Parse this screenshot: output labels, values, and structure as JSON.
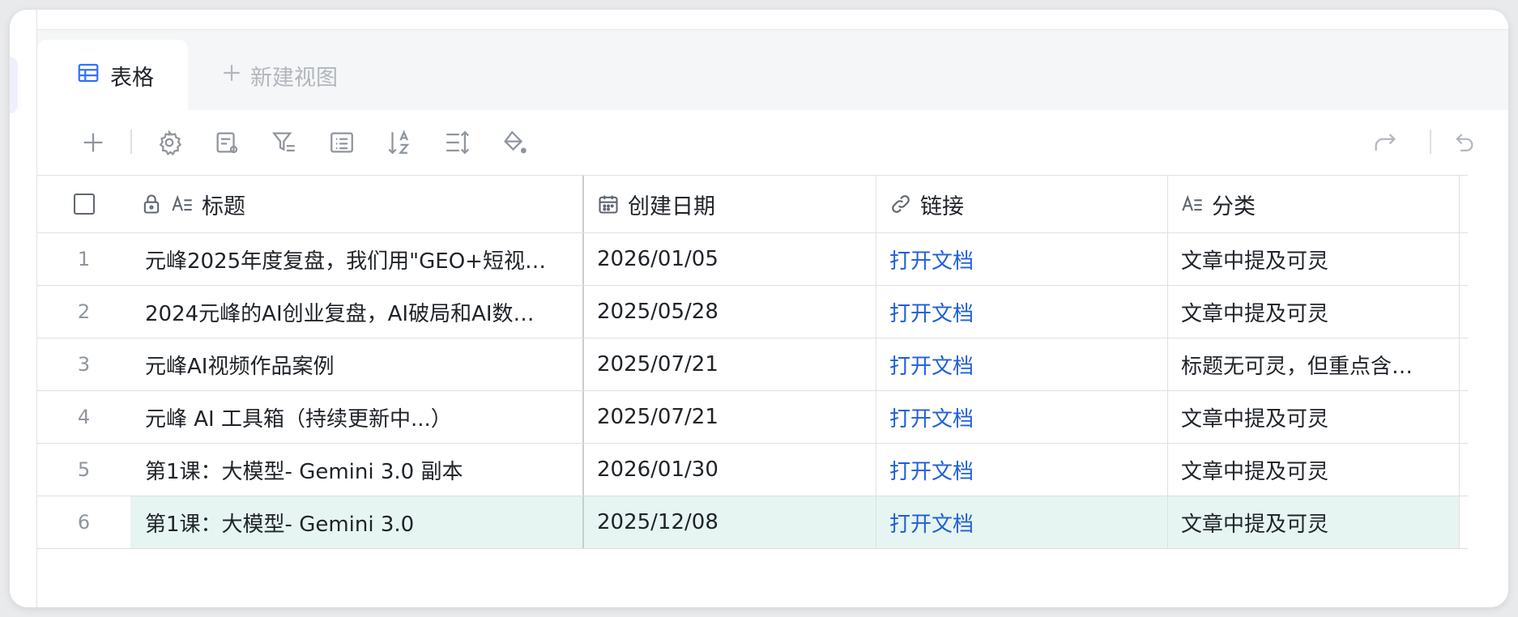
{
  "tabs": {
    "active_label": "表格",
    "new_view_label": "新建视图"
  },
  "toolbar": {
    "icons": [
      "plus-icon",
      "gear-icon",
      "field-settings-icon",
      "filter-icon",
      "group-icon",
      "sort-icon",
      "row-height-icon",
      "fill-color-icon",
      "redo-icon",
      "undo-icon"
    ]
  },
  "table": {
    "headers": {
      "title": "标题",
      "date": "创建日期",
      "link": "链接",
      "category": "分类"
    },
    "rows": [
      {
        "index": "1",
        "title": "元峰2025年度复盘，我们用\"GEO+短视…",
        "date": "2026/01/05",
        "link": "打开文档",
        "category": "文章中提及可灵"
      },
      {
        "index": "2",
        "title": "2024元峰的AI创业复盘，AI破局和AI数…",
        "date": "2025/05/28",
        "link": "打开文档",
        "category": "文章中提及可灵"
      },
      {
        "index": "3",
        "title": "元峰AI视频作品案例",
        "date": "2025/07/21",
        "link": "打开文档",
        "category": "标题无可灵，但重点含…"
      },
      {
        "index": "4",
        "title": "元峰 AI 工具箱（持续更新中...）",
        "date": "2025/07/21",
        "link": "打开文档",
        "category": "文章中提及可灵"
      },
      {
        "index": "5",
        "title": "第1课：大模型- Gemini 3.0 副本",
        "date": "2026/01/30",
        "link": "打开文档",
        "category": "文章中提及可灵"
      },
      {
        "index": "6",
        "title": "第1课：大模型- Gemini 3.0",
        "date": "2025/12/08",
        "link": "打开文档",
        "category": "文章中提及可灵"
      }
    ]
  },
  "colors": {
    "accent": "#1f5fd9",
    "selected_row": "#e6f5f1"
  }
}
